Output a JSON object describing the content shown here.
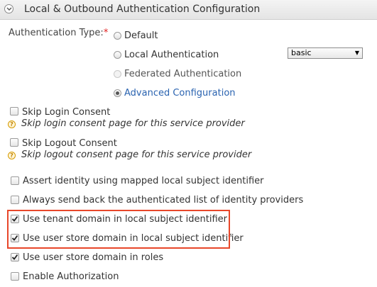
{
  "header": {
    "title": "Local & Outbound Authentication Configuration",
    "toggle_icon": "chevron-collapse-icon"
  },
  "auth_type": {
    "label": "Authentication Type:",
    "required_marker": "*",
    "options": [
      {
        "label": "Default",
        "selected": false,
        "disabled": false
      },
      {
        "label": "Local Authentication",
        "selected": false,
        "disabled": false
      },
      {
        "label": "Federated Authentication",
        "selected": false,
        "disabled": true
      },
      {
        "label": "Advanced Configuration",
        "selected": true,
        "disabled": false
      }
    ],
    "local_auth_select": {
      "value": "basic"
    }
  },
  "skip_login": {
    "label": "Skip Login Consent",
    "checked": false,
    "help": "Skip login consent page for this service provider"
  },
  "skip_logout": {
    "label": "Skip Logout Consent",
    "checked": false,
    "help": "Skip logout consent page for this service provider"
  },
  "options": [
    {
      "label": "Assert identity using mapped local subject identifier",
      "checked": false
    },
    {
      "label": "Always send back the authenticated list of identity providers",
      "checked": false
    },
    {
      "label": "Use tenant domain in local subject identifier",
      "checked": true
    },
    {
      "label": "Use user store domain in local subject identifier",
      "checked": true
    },
    {
      "label": "Use user store domain in roles",
      "checked": true
    },
    {
      "label": "Enable Authorization",
      "checked": false
    }
  ],
  "colors": {
    "highlight_border": "#e8472a",
    "link": "#2a63b0",
    "required": "#e02020"
  }
}
